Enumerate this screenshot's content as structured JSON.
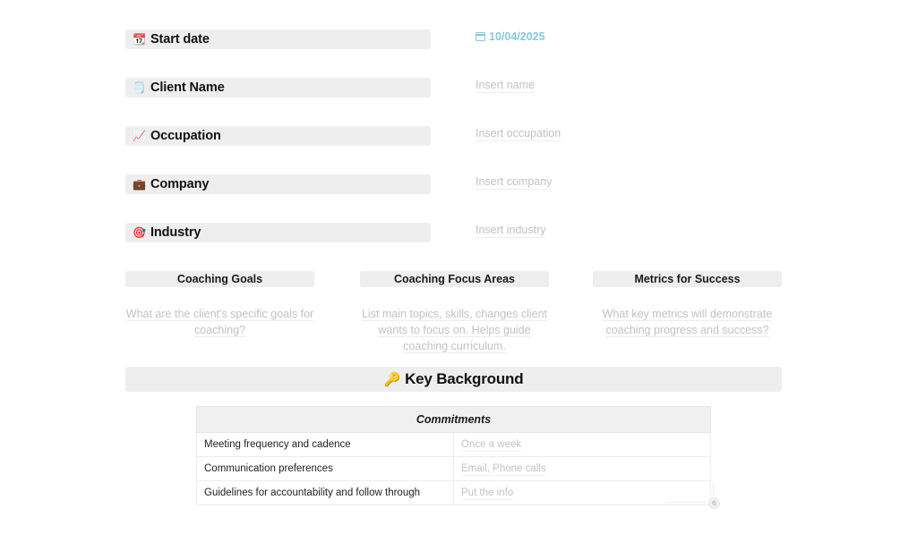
{
  "fields": [
    {
      "icon": "calendar-icon",
      "emoji": "📆",
      "label": "Start date",
      "value": "10/04/2025",
      "value_kind": "date",
      "value_color": "#86c8da"
    },
    {
      "icon": "note-card-icon",
      "emoji": "🗒️",
      "label": "Client Name",
      "value": "Insert name",
      "value_kind": "placeholder"
    },
    {
      "icon": "chart-increasing-icon",
      "emoji": "📈",
      "label": "Occupation",
      "value": "Insert occupation",
      "value_kind": "placeholder"
    },
    {
      "icon": "briefcase-icon",
      "emoji": "💼",
      "label": "Company",
      "value": "Insert company",
      "value_kind": "placeholder"
    },
    {
      "icon": "dart-target-icon",
      "emoji": "🎯",
      "label": "Industry",
      "value": "Insert industry",
      "value_kind": "placeholder"
    }
  ],
  "columns": [
    {
      "heading": "Coaching Goals",
      "body": "What are the client's specific goals for coaching?"
    },
    {
      "heading": "Coaching Focus Areas",
      "body": "List main topics, skills, changes client wants to focus on. Helps guide coaching curriculum."
    },
    {
      "heading": "Metrics for Success",
      "body": "What key metrics will demonstrate coaching progress and success?"
    }
  ],
  "banner": {
    "icon": "key-icon",
    "emoji": "🔑",
    "title": "Key Background"
  },
  "table": {
    "header": "Commitments",
    "rows": [
      {
        "label": "Meeting frequency and cadence",
        "value": "Once a week"
      },
      {
        "label": "Communication preferences",
        "value": "Email, Phone calls"
      },
      {
        "label": "Guidelines for accountability and follow through",
        "value": "Put the info"
      }
    ]
  },
  "colors": {
    "pill_background": "#eeeeee",
    "placeholder_text": "#c2c2c2",
    "date_accent": "#86c8da",
    "page_background": "#ffffff"
  }
}
